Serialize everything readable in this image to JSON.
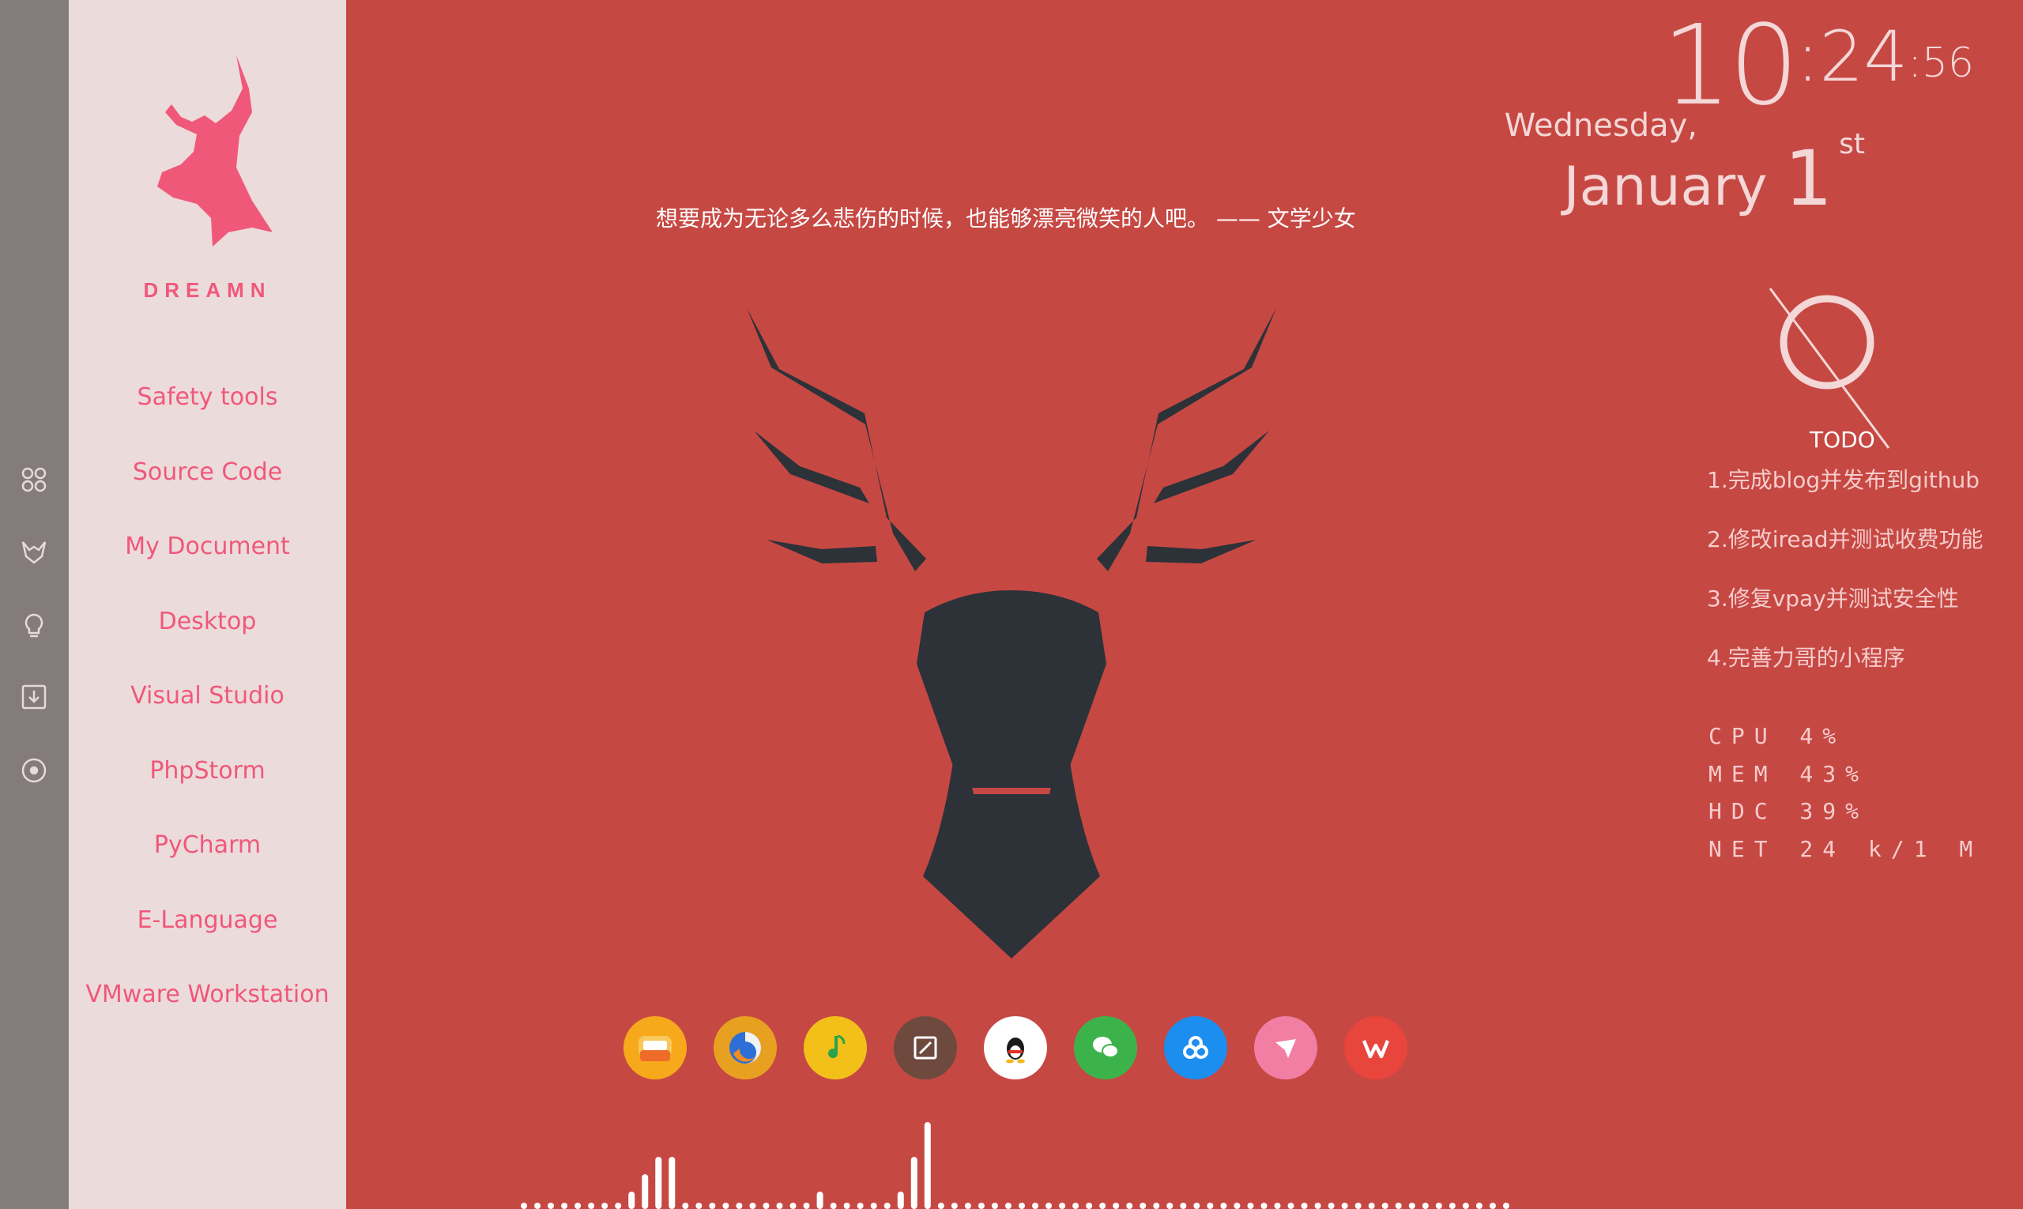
{
  "brand": {
    "name": "DREAMN",
    "accent": "#f0587a"
  },
  "sidebar": {
    "items": [
      {
        "label": "Safety tools"
      },
      {
        "label": "Source Code"
      },
      {
        "label": "My Document"
      },
      {
        "label": "Desktop"
      },
      {
        "label": "Visual Studio"
      },
      {
        "label": "PhpStorm"
      },
      {
        "label": "PyCharm"
      },
      {
        "label": "E-Language"
      },
      {
        "label": "VMware Workstation"
      }
    ]
  },
  "strip": {
    "icons": [
      "command-icon",
      "fox-icon",
      "lightbulb-icon",
      "download-icon",
      "target-icon"
    ]
  },
  "quote": {
    "text": "想要成为无论多么悲伤的时候，也能够漂亮微笑的人吧。 —— 文学少女"
  },
  "clock": {
    "hour": "10",
    "minute": ":24",
    "second": ":56",
    "weekday": "Wednesday,",
    "month": "January",
    "day": "1",
    "suffix": "st"
  },
  "todo": {
    "title": "TODO",
    "items": [
      "1.完成blog并发布到github",
      "2.修改iread并测试收费功能",
      "3.修复vpay并测试安全性",
      "4.完善力哥的小程序"
    ]
  },
  "stats": [
    {
      "text": "CPU 4%"
    },
    {
      "text": "MEM 43%"
    },
    {
      "text": "HDC 39%"
    },
    {
      "text": "NET 24 k/1 M"
    }
  ],
  "dock": {
    "icons": [
      {
        "name": "messages-icon",
        "color": "#f6a91b"
      },
      {
        "name": "firefox-icon",
        "color": "#e8a020"
      },
      {
        "name": "music-icon",
        "color": "#f2c019"
      },
      {
        "name": "editor-icon",
        "color": "#6e4a3e"
      },
      {
        "name": "qq-icon",
        "color": "#ffffff"
      },
      {
        "name": "wechat-icon",
        "color": "#3cb34a"
      },
      {
        "name": "baidu-cloud-icon",
        "color": "#1c8ef0"
      },
      {
        "name": "pointer-icon",
        "color": "#f27ea3"
      },
      {
        "name": "wps-icon",
        "color": "#e8453c"
      }
    ]
  },
  "visualizer": {
    "levels": [
      0,
      0,
      0,
      0,
      0,
      0,
      0,
      0,
      1,
      2,
      3,
      3,
      0,
      0,
      0,
      0,
      0,
      0,
      0,
      0,
      0,
      0,
      1,
      0,
      0,
      0,
      0,
      0,
      1,
      3,
      5,
      0,
      0,
      0,
      0,
      0,
      0,
      0,
      0,
      0,
      0,
      0,
      0,
      0,
      0,
      0,
      0,
      0,
      0,
      0,
      0,
      0,
      0,
      0,
      0,
      0,
      0,
      0,
      0,
      0,
      0,
      0,
      0,
      0,
      0,
      0,
      0,
      0,
      0,
      0,
      0,
      0,
      0,
      0
    ]
  },
  "colors": {
    "background": "#c64843",
    "sidebar": "#ecdbdb",
    "strip": "#847b7b",
    "deer": "#2c3238"
  }
}
